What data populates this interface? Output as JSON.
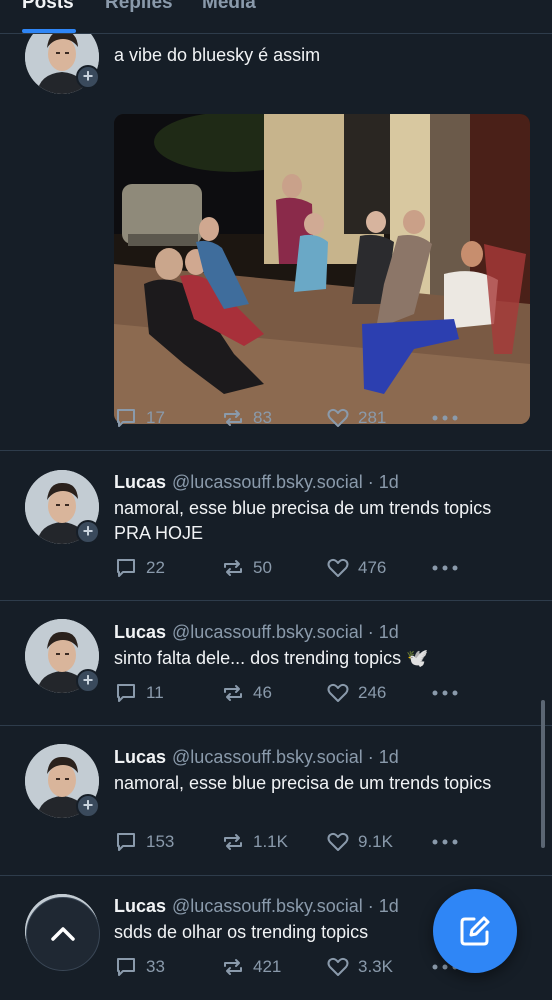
{
  "tabs": [
    {
      "label": "Posts",
      "active": true
    },
    {
      "label": "Replies",
      "active": false
    },
    {
      "label": "Media",
      "active": false
    }
  ],
  "posts": [
    {
      "text": "a vibe do bluesky é assim",
      "reply": "17",
      "repost": "83",
      "like": "281"
    },
    {
      "name": "Lucas",
      "handle": "@lucassouff.bsky.social",
      "time": "· 1d",
      "text": "namoral, esse blue precisa de um trends topics PRA HOJE",
      "reply": "22",
      "repost": "50",
      "like": "476"
    },
    {
      "name": "Lucas",
      "handle": "@lucassouff.bsky.social",
      "time": "· 1d",
      "text": "sinto falta dele... dos trending topics 🕊️",
      "reply": "11",
      "repost": "46",
      "like": "246"
    },
    {
      "name": "Lucas",
      "handle": "@lucassouff.bsky.social",
      "time": "· 1d",
      "text": "namoral, esse blue precisa de um trends topics",
      "reply": "153",
      "repost": "1.1K",
      "like": "9.1K"
    },
    {
      "name": "Lucas",
      "handle": "@lucassouff.bsky.social",
      "time": "· 1d",
      "text": "sdds de olhar os trending topics",
      "reply": "33",
      "repost": "421",
      "like": "3.3K"
    }
  ],
  "icons": {
    "reply": "reply-icon",
    "repost": "repost-icon",
    "like": "heart-icon",
    "more": "more-icon",
    "compose": "compose-icon",
    "scroll_top": "chevron-up-icon"
  },
  "colors": {
    "accent": "#2f86f6",
    "background": "#161e27",
    "muted": "#8a9aab"
  }
}
